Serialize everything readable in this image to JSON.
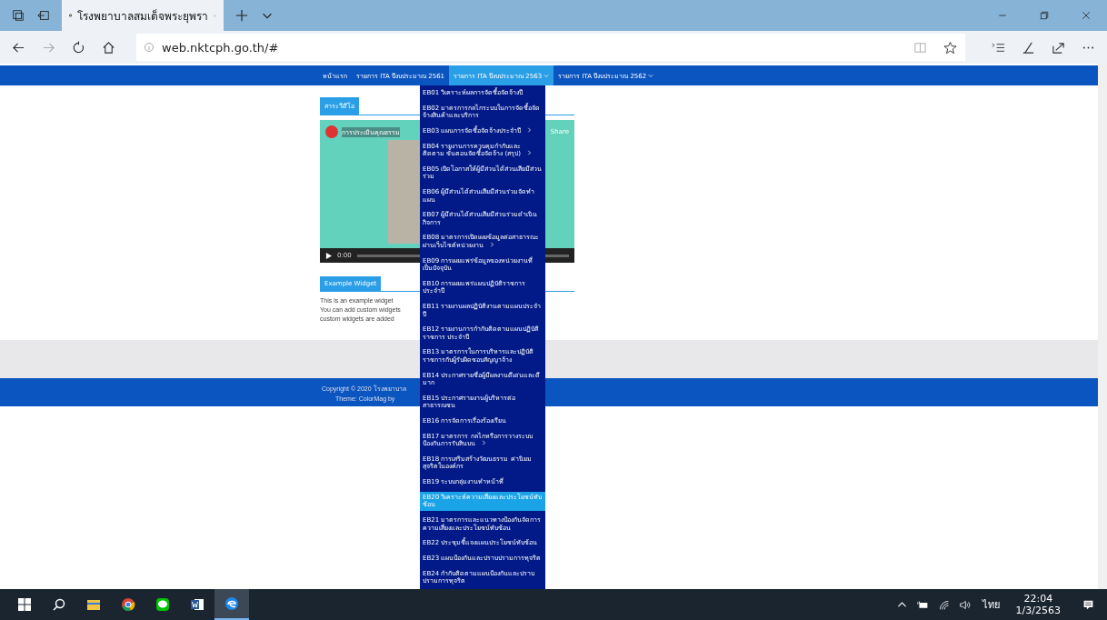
{
  "browser": {
    "tab_title": "โรงพยาบาลสมเด็จพระยุพรา",
    "url": "web.nktcph.go.th/#"
  },
  "nav": [
    {
      "label": "หน้าแรก",
      "dropdown": false,
      "selected": false
    },
    {
      "label": "รายการ ITA ปีงบประมาณ 2561",
      "dropdown": false,
      "selected": false
    },
    {
      "label": "รายการ ITA ปีงบประมาณ 2563",
      "dropdown": true,
      "selected": true
    },
    {
      "label": "รายการ ITA ปีงบประมาณ 2562",
      "dropdown": true,
      "selected": false
    }
  ],
  "video_widget": {
    "heading": "สาระวีดีโอ",
    "video_title": "การประเมินคุณธรรม",
    "share": "Share",
    "time": "0:00"
  },
  "example_widget": {
    "heading": "Example Widget",
    "lines": [
      "This is an example widget",
      "You can add custom widgets",
      "custom widgets are added"
    ]
  },
  "footer": {
    "lines": [
      "Copyright © 2020 โรงพยาบาล",
      "Theme: ColorMag by"
    ]
  },
  "menu": [
    {
      "label": "EB01 วิเคราะห์ผลการจัดซื้อจัดจ้างปี",
      "submenu": false,
      "selected": false
    },
    {
      "label": "EB02 มาตรการกลไกระบบในการจัดซื้อจัดจ้างสินค้าและบริการ",
      "submenu": false,
      "selected": false
    },
    {
      "label": "EB03 แผนการจัดซื้อจัดจ้างประจำปี",
      "submenu": true,
      "selected": false
    },
    {
      "label": "EB04 รายงานการควบคุมกำกับและติดตาม ขั้นตอนจัดซื้อจัดจ้าง (สรุป)",
      "submenu": true,
      "selected": false
    },
    {
      "label": "EB05 เปิดโอกาสให้ผู้มีส่วนได้ส่วนเสียมีส่วนร่วม",
      "submenu": false,
      "selected": false
    },
    {
      "label": "EB06 ผู้มีส่วนได้ส่วนเสียมีส่วนร่วมจัดทำแผน",
      "submenu": false,
      "selected": false
    },
    {
      "label": "EB07 ผู้มีส่วนได้ส่วนเสียมีส่วนร่วมดำเนินกิจการ",
      "submenu": false,
      "selected": false
    },
    {
      "label": "EB08 มาตรการเปิดเผยข้อมูลต่อสาธารณะผ่านเว็บไซต์หน่วยงาน",
      "submenu": true,
      "selected": false
    },
    {
      "label": "EB09 การเผยแพร่ข้อมูลของหน่วยงานที่เป็นปัจจุบัน",
      "submenu": false,
      "selected": false
    },
    {
      "label": "EB10 การเผยแพร่แผนปฏิบัติราชการประจำปี",
      "submenu": false,
      "selected": false
    },
    {
      "label": "EB11 รายงานผลปฏิบัติงานตามแผนประจำปี",
      "submenu": false,
      "selected": false
    },
    {
      "label": "EB12 รายงานการกำกับติดตามแผนปฏิบัติราชการ ประจำปี",
      "submenu": false,
      "selected": false
    },
    {
      "label": "EB13 มาตรการในการบริหารและปฏิบัติราชการกับผู้รับผิดชอบสัญญาจ้าง",
      "submenu": false,
      "selected": false
    },
    {
      "label": "EB14 ประกาศรายชื่อผู้มีผลงานดีเด่นและดีมาก",
      "submenu": false,
      "selected": false
    },
    {
      "label": "EB15 ประกาศรายงานผู้บริหารต่อสาธารณชน",
      "submenu": false,
      "selected": false
    },
    {
      "label": "EB16 การจัดการเรื่องร้องเรียน",
      "submenu": false,
      "selected": false
    },
    {
      "label": "EB17 มาตรการ กลไกหรือการวางระบบป้องกันการรับสินบน",
      "submenu": true,
      "selected": false
    },
    {
      "label": "EB18 การเสริมสร้างวัฒนธรรม ค่านิยมสุจริตในองค์กร",
      "submenu": false,
      "selected": false
    },
    {
      "label": "EB19 ระบบกลุ่มงานทำหน้าที่",
      "submenu": false,
      "selected": false
    },
    {
      "label": "EB20 วิเคราะห์ความเสี่ยงและประโยชน์ทับซ้อน",
      "submenu": false,
      "selected": true
    },
    {
      "label": "EB21 มาตรการและแนวทางป้องกันจัดการความเสี่ยงและประโยชน์ทับซ้อน",
      "submenu": false,
      "selected": false
    },
    {
      "label": "EB22 ประชุมชี้แจงแผนประโยชน์ทับซ้อน",
      "submenu": false,
      "selected": false
    },
    {
      "label": "EB23 แผนป้องกันและปราบปรามการทุจริต",
      "submenu": false,
      "selected": false
    },
    {
      "label": "EB24 กำกับติดตามแผนป้องกันและปราบปรามการทุจริต",
      "submenu": false,
      "selected": false
    }
  ],
  "tray": {
    "language": "ไทย",
    "time": "22:04",
    "date": "1/3/2563"
  }
}
